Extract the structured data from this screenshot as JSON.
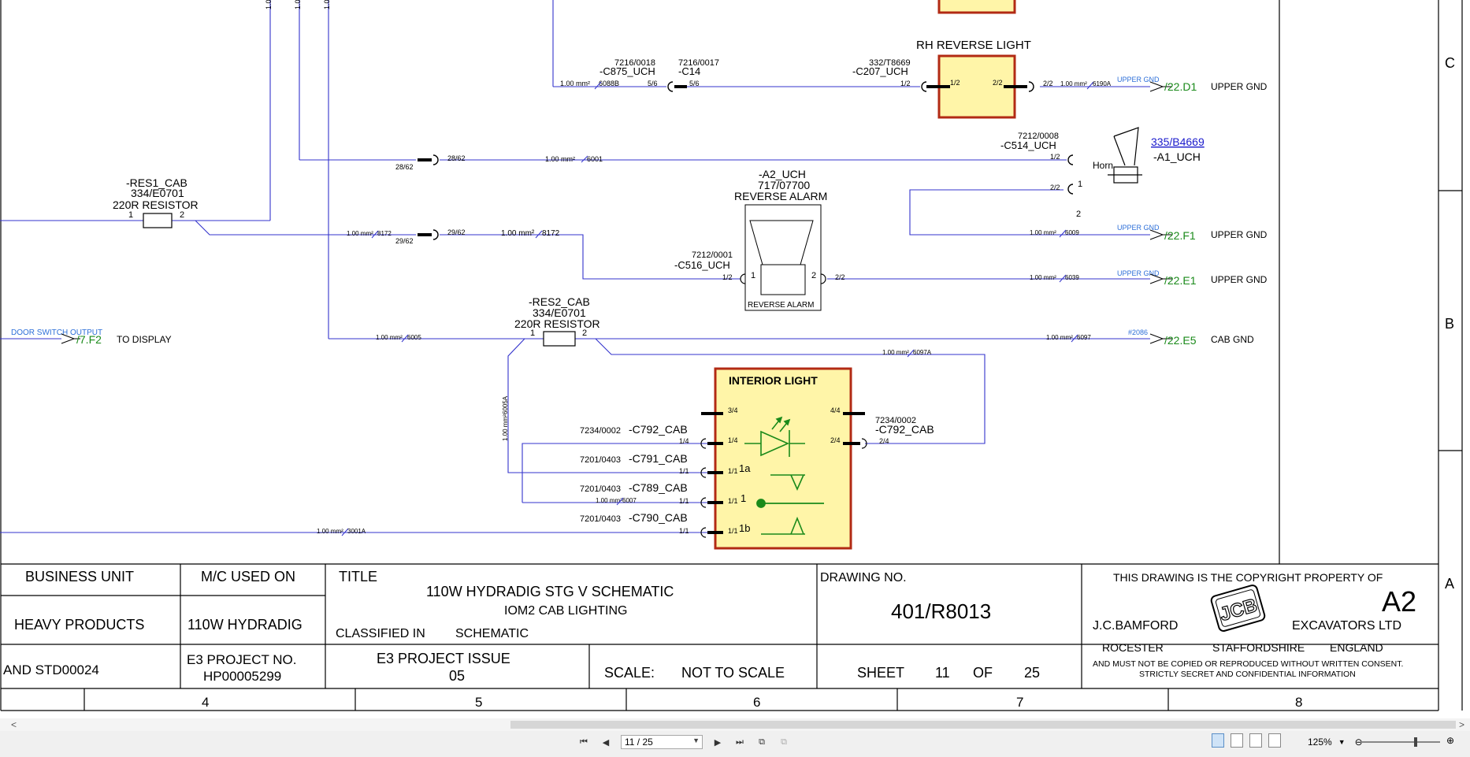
{
  "titleblock": {
    "business_unit_label": "BUSINESS UNIT",
    "business_unit_value": "HEAVY PRODUCTS",
    "standard": "AND STD00024",
    "mc_used_on_label": "M/C USED ON",
    "mc_used_on_value": "110W HYDRADIG",
    "e3_project_no_label": "E3 PROJECT NO.",
    "e3_project_no_value": "HP00005299",
    "title_label": "TITLE",
    "title_main": "110W HYDRADIG STG V SCHEMATIC",
    "title_sub": "IOM2 CAB LIGHTING",
    "classified_label": "CLASSIFIED IN",
    "classified_value": "SCHEMATIC",
    "e3_issue_label": "E3 PROJECT ISSUE",
    "e3_issue_value": "05",
    "scale_label": "SCALE:",
    "scale_value": "NOT TO SCALE",
    "drawing_no_label": "DRAWING NO.",
    "drawing_no_value": "401/R8013",
    "sheet_label": "SHEET",
    "sheet_value": "11",
    "of_label": "OF",
    "of_value": "25",
    "copyright_line": "THIS DRAWING IS THE COPYRIGHT PROPERTY OF",
    "paper_size": "A2",
    "company_left": "J.C.BAMFORD",
    "company_right": "EXCAVATORS LTD",
    "logo_text": "JCB",
    "addr_1": "ROCESTER",
    "addr_2": "STAFFORDSHIRE",
    "addr_3": "ENGLAND",
    "notice_1": "AND MUST NOT BE COPIED OR REPRODUCED WITHOUT WRITTEN CONSENT.",
    "notice_2": "STRICTLY SECRET AND CONFIDENTIAL INFORMATION"
  },
  "grid": {
    "columns": [
      "4",
      "5",
      "6",
      "7",
      "8"
    ],
    "rows": [
      "C",
      "B",
      "A"
    ]
  },
  "top_stub_labels": [
    "1.00",
    "1.00",
    "1.00"
  ],
  "schematic": {
    "rh_reverse_light": {
      "title": "RH REVERSE LIGHT",
      "conn_ref": "332/T8669",
      "conn": "-C207_UCH",
      "pin_left": "1/2",
      "pin_inner_left": "1/2",
      "pin_inner_right": "2/2",
      "pin_right": "2/2",
      "wire_right": "1.00 mm²",
      "wire_right_id": "6190A",
      "upper_gnd": "UPPER GND",
      "xref": "/22.D1",
      "gnd_label": "UPPER GND"
    },
    "c875": {
      "ref": "7216/0018",
      "name": "-C875_UCH",
      "wire": "1.00 mm²",
      "wire_id": "6088B",
      "pin": "5/6"
    },
    "c14": {
      "ref": "7216/0017",
      "name": "-C14",
      "pin": "5/6"
    },
    "splice_28": {
      "left": "28/62",
      "right": "28/62",
      "wire": "1.00 mm²",
      "wire_id": "6001"
    },
    "horn": {
      "conn_ref": "7212/0008",
      "conn": "-C514_UCH",
      "pin1": "1/2",
      "pin2": "2/2",
      "num1": "1",
      "num2": "2",
      "link": "335/B4669",
      "name": "-A1_UCH",
      "label": "Horn",
      "gnd_wire": "1.00 mm²",
      "gnd_wire_id": "6009",
      "upper_gnd": "UPPER GND",
      "xref": "/22.F1",
      "gnd_label": "UPPER GND"
    },
    "res1": {
      "name": "-RES1_CAB",
      "ref": "334/E0701",
      "desc": "220R RESISTOR",
      "pin1": "1",
      "pin2": "2"
    },
    "splice_29": {
      "wire_left": "1.00 mm²",
      "wire_left_id": "8172",
      "left": "29/62",
      "right": "29/62",
      "wire_right": "1.00 mm²",
      "wire_right_id": "8172"
    },
    "reverse_alarm": {
      "name": "-A2_UCH",
      "ref": "717/07700",
      "desc": "REVERSE ALARM",
      "conn_ref": "7212/0001",
      "conn": "-C516_UCH",
      "pin_in": "1/2",
      "pin_out": "2/2",
      "num1": "1",
      "num2": "2",
      "box_label": "REVERSE ALARM",
      "gnd_wire": "1.00 mm²",
      "gnd_wire_id": "6039",
      "upper_gnd": "UPPER GND",
      "xref": "/22.E1",
      "gnd_label": "UPPER GND"
    },
    "door_switch": {
      "label": "DOOR SWITCH OUTPUT",
      "xref": "/7.F2",
      "dest": "TO DISPLAY"
    },
    "res2": {
      "name": "-RES2_CAB",
      "ref": "334/E0701",
      "desc": "220R RESISTOR",
      "pin1": "1",
      "pin2": "2",
      "wire_left": "1.00 mm²",
      "wire_left_id": "6005",
      "wire_right": "1.00 mm²",
      "wire_right_id": "6097",
      "wire_down": "1.00 mm²",
      "wire_down_id": "6005A",
      "wire_loop": "1.00 mm²",
      "wire_loop_id": "6097A",
      "net": "#2086",
      "xref": "/22.E5",
      "gnd_label": "CAB GND"
    },
    "interior_light": {
      "title": "INTERIOR LIGHT",
      "left_pins": [
        {
          "pin": "3/4",
          "ref": "",
          "conn": "",
          "outer": "",
          "inner": ""
        },
        {
          "pin": "1/4",
          "ref": "7234/0002",
          "conn": "-C792_CAB",
          "outer": "1/4",
          "inner": ""
        },
        {
          "pin": "1/1",
          "ref": "7201/0403",
          "conn": "-C791_CAB",
          "outer": "1/1",
          "inner": "1a"
        },
        {
          "pin": "1/1",
          "ref": "7201/0403",
          "conn": "-C789_CAB",
          "outer": "1/1",
          "inner": "1"
        },
        {
          "pin": "1/1",
          "ref": "7201/0403",
          "conn": "-C790_CAB",
          "outer": "1/1",
          "inner": "1b"
        }
      ],
      "right_pins": [
        {
          "pin": "4/4"
        },
        {
          "pin": "2/4",
          "outer": "2/4"
        }
      ],
      "right_conn_ref": "7234/0002",
      "right_conn": "-C792_CAB",
      "wire_6007": "1.00 mm²",
      "wire_6007_id": "6007",
      "wire_3001": "1.00 mm²",
      "wire_3001_id": "3001A"
    }
  },
  "viewer": {
    "page_input": "11 / 25",
    "zoom": "125%",
    "scroll_left": "<",
    "scroll_right": ">"
  },
  "colors": {
    "wire": "#3333cc",
    "component_fill": "#fff5a8",
    "component_border": "#b22a14",
    "xref_green": "#1a8a1a",
    "net_blue": "#2d6fd8"
  }
}
